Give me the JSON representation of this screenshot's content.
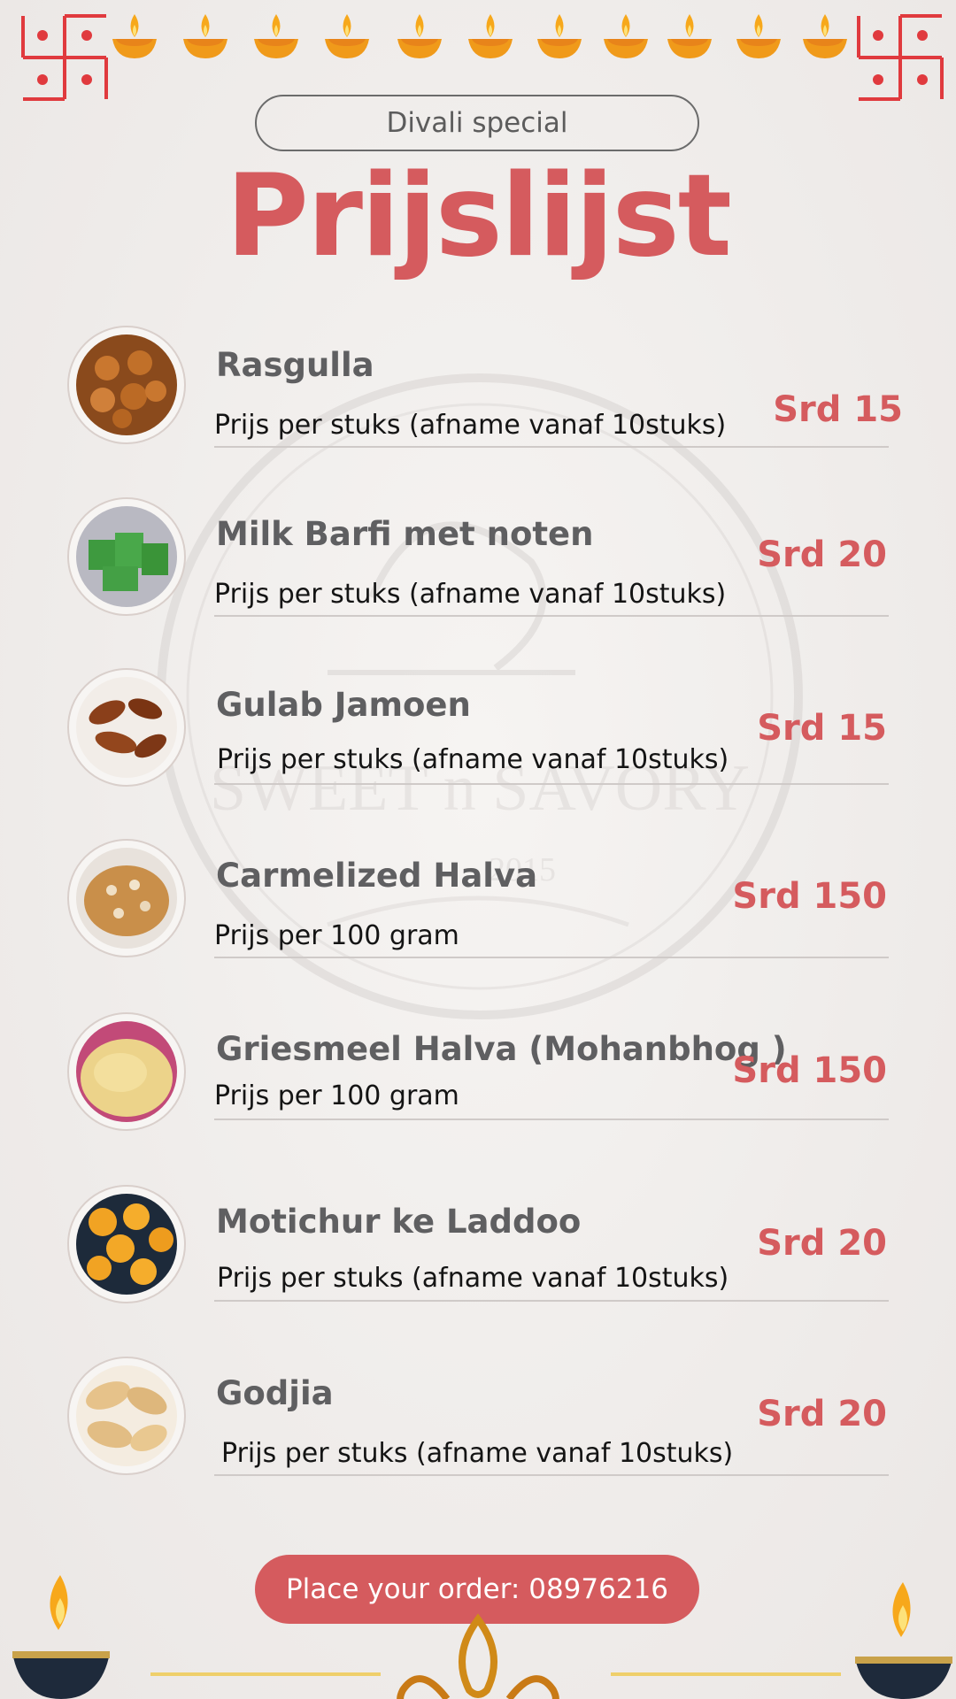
{
  "header": {
    "subtitle": "Divali special",
    "title": "Prijslijst"
  },
  "items": [
    {
      "name": "Rasgulla",
      "desc": "Prijs per stuks (afname vanaf 10stuks)",
      "price": "Srd 15"
    },
    {
      "name": "Milk Barfi met noten",
      "desc": "Prijs per stuks (afname vanaf 10stuks)",
      "price": "Srd 20"
    },
    {
      "name": "Gulab Jamoen",
      "desc": "Prijs per stuks (afname vanaf 10stuks)",
      "price": "Srd 15"
    },
    {
      "name": "Carmelized Halva",
      "desc": "Prijs per 100 gram",
      "price": "Srd 150"
    },
    {
      "name": "Griesmeel Halva (Mohanbhog )",
      "desc": "Prijs per 100 gram",
      "price": "Srd 150"
    },
    {
      "name": "Motichur ke Laddoo",
      "desc": "Prijs per stuks (afname vanaf 10stuks)",
      "price": "Srd 20"
    },
    {
      "name": "Godjia",
      "desc": "Prijs per stuks (afname vanaf 10stuks)",
      "price": "Srd 20"
    }
  ],
  "watermark": {
    "brand": "SWEET n SAVORY",
    "year": "2015"
  },
  "footer": {
    "order_label": "Place your order: 08976216"
  },
  "colors": {
    "accent": "#d55b5e",
    "name_text": "#5f5f61",
    "background": "#f1eeec"
  }
}
